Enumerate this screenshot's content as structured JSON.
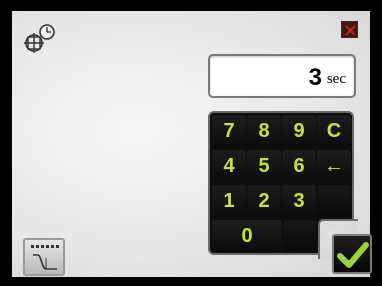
{
  "display": {
    "value": "3",
    "unit": "sec"
  },
  "keypad": {
    "keys": [
      "7",
      "8",
      "9",
      "C",
      "4",
      "5",
      "6",
      "←",
      "1",
      "2",
      "3",
      "0"
    ]
  },
  "icons": {
    "timer": "timer-settings-icon",
    "close": "close-icon",
    "confirm": "checkmark-icon",
    "signal": "signal-curve-icon"
  },
  "colors": {
    "key_text": "#c9e23a",
    "confirm": "#9bd23a",
    "close_x": "#c02020"
  }
}
